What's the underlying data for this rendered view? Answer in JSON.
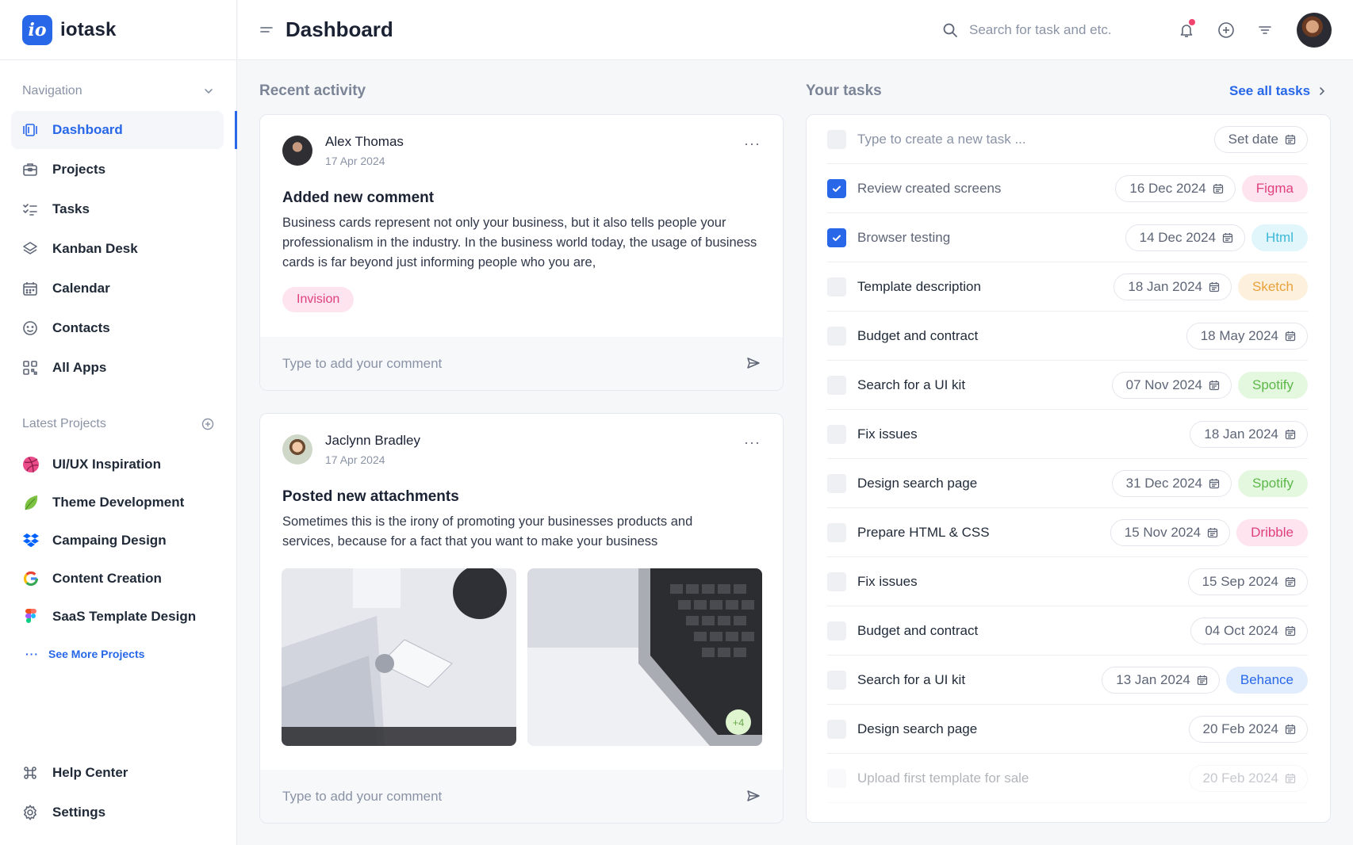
{
  "brand": {
    "logo": "io",
    "name": "iotask"
  },
  "sidebar": {
    "nav_heading": "Navigation",
    "nav": [
      {
        "label": "Dashboard",
        "icon": "dashboard-icon"
      },
      {
        "label": "Projects",
        "icon": "briefcase-icon"
      },
      {
        "label": "Tasks",
        "icon": "checklist-icon"
      },
      {
        "label": "Kanban Desk",
        "icon": "layers-icon"
      },
      {
        "label": "Calendar",
        "icon": "calendar-icon"
      },
      {
        "label": "Contacts",
        "icon": "smile-icon"
      },
      {
        "label": "All Apps",
        "icon": "apps-grid-icon"
      }
    ],
    "projects_heading": "Latest Projects",
    "projects": [
      {
        "label": "UI/UX Inspiration",
        "icon": "dribbble-icon"
      },
      {
        "label": "Theme Development",
        "icon": "leaf-icon"
      },
      {
        "label": "Campaing Design",
        "icon": "dropbox-icon"
      },
      {
        "label": "Content Creation",
        "icon": "google-icon"
      },
      {
        "label": "SaaS Template Design",
        "icon": "figma-icon"
      }
    ],
    "see_more": "See More Projects",
    "bottom": [
      {
        "label": "Help Center",
        "icon": "command-icon"
      },
      {
        "label": "Settings",
        "icon": "gear-icon"
      }
    ]
  },
  "header": {
    "title": "Dashboard",
    "search_placeholder": "Search for task and etc."
  },
  "activity": {
    "heading": "Recent activity",
    "comment_placeholder": "Type to add your comment",
    "posts": [
      {
        "author": "Alex Thomas",
        "date": "17 Apr 2024",
        "title": "Added new comment",
        "body": "Business cards represent not only your business, but it also tells people your professionalism in the industry. In the business world today, the usage of business cards is far beyond just informing people who you are,",
        "tag": "Invision"
      },
      {
        "author": "Jaclynn Bradley",
        "date": "17 Apr 2024",
        "title": "Posted new attachments",
        "body": "Sometimes this is the irony of promoting your businesses products and services, because for a fact that you want to make your business",
        "more_count": "+4"
      }
    ]
  },
  "tasks": {
    "heading": "Your tasks",
    "see_all": "See all tasks",
    "new_placeholder": "Type to create a new task ...",
    "set_date": "Set date",
    "items": [
      {
        "label": "Review created screens",
        "date": "16 Dec 2024",
        "done": true,
        "tag": "Figma"
      },
      {
        "label": "Browser testing",
        "date": "14 Dec 2024",
        "done": true,
        "tag": "Html"
      },
      {
        "label": "Template description",
        "date": "18 Jan 2024",
        "done": false,
        "tag": "Sketch"
      },
      {
        "label": "Budget and contract",
        "date": "18 May 2024",
        "done": false,
        "tag": ""
      },
      {
        "label": "Search for a UI kit",
        "date": "07 Nov 2024",
        "done": false,
        "tag": "Spotify"
      },
      {
        "label": "Fix issues",
        "date": "18 Jan 2024",
        "done": false,
        "tag": ""
      },
      {
        "label": "Design search page",
        "date": "31 Dec 2024",
        "done": false,
        "tag": "Spotify"
      },
      {
        "label": "Prepare HTML & CSS",
        "date": "15 Nov 2024",
        "done": false,
        "tag": "Dribble"
      },
      {
        "label": "Fix issues",
        "date": "15 Sep 2024",
        "done": false,
        "tag": ""
      },
      {
        "label": "Budget and contract",
        "date": "04 Oct 2024",
        "done": false,
        "tag": ""
      },
      {
        "label": "Search for a UI kit",
        "date": "13 Jan 2024",
        "done": false,
        "tag": "Behance"
      },
      {
        "label": "Design search page",
        "date": "20 Feb 2024",
        "done": false,
        "tag": ""
      },
      {
        "label": "Upload first template for sale",
        "date": "20 Feb 2024",
        "done": false,
        "tag": ""
      }
    ]
  },
  "colors": {
    "accent": "#2767e8",
    "notification": "#f0436d",
    "tag_figma": "#fde4ee",
    "tag_html": "#e1f6fb",
    "tag_sketch": "#fdf0dc",
    "tag_spotify": "#e4f7df",
    "tag_dribble": "#fde4ee",
    "tag_behance": "#e1ecfd"
  }
}
